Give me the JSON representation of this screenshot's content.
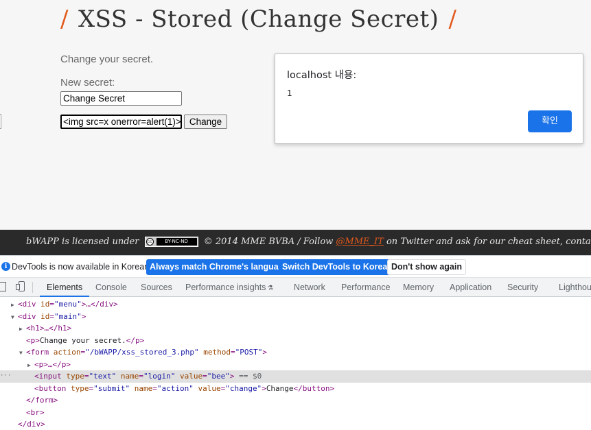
{
  "page": {
    "title": "XSS - Stored (Change Secret)",
    "title_slash": "/",
    "intro": "Change your secret.",
    "new_secret_label": "New secret:",
    "secret_value": "Change Secret",
    "login_value": "<img src=x onerror=alert(1)>",
    "change_label": "Change"
  },
  "dialog": {
    "title": "localhost 내용:",
    "message": "1",
    "ok_label": "확인"
  },
  "footer": {
    "licensed": "bWAPP is licensed under",
    "cc_icon": "cc",
    "cc_text": "BY-NC-ND",
    "follow": "© 2014 MME BVBA / Follow",
    "handle": "@MME_IT",
    "rest": "on Twitter and ask for our cheat sheet, contai"
  },
  "devtools": {
    "info_icon": "i",
    "info_text": "DevTools is now available in Korean!",
    "match_label": "Always match Chrome's language",
    "switch_label": "Switch DevTools to Korean",
    "dismiss_label": "Don't show again",
    "tabs": {
      "elements": "Elements",
      "console": "Console",
      "sources": "Sources",
      "performance_insights": "Performance insights",
      "network": "Network",
      "performance": "Performance",
      "memory": "Memory",
      "application": "Application",
      "security": "Security",
      "lighthouse": "Lighthou"
    },
    "dom": {
      "r1": {
        "tag": "<div",
        "a1": " id",
        "v1": "\"menu\"",
        "end": ">…</div>"
      },
      "r2": {
        "tag": "<div",
        "a1": " id",
        "v1": "\"main\"",
        "end": ">"
      },
      "r3": {
        "tag": "<h1>…</h1>"
      },
      "r4": {
        "open": "<p>",
        "text": "Change your secret.",
        "close": "</p>"
      },
      "r5": {
        "tag": "<form",
        "a1": " action",
        "v1": "\"/bWAPP/xss_stored_3.php\"",
        "a2": " method",
        "v2": "\"POST\"",
        "end": ">"
      },
      "r6": {
        "tag": "<p>…</p>"
      },
      "r7": {
        "tag": "<input",
        "a1": " type",
        "v1": "\"text\"",
        "a2": " name",
        "v2": "\"login\"",
        "a3": " value",
        "v3": "\"bee\"",
        "end": ">",
        "marker": " == $0"
      },
      "r8": {
        "tag": "<button",
        "a1": " type",
        "v1": "\"submit\"",
        "a2": " name",
        "v2": "\"action\"",
        "a3": " value",
        "v3": "\"change\"",
        "end": ">",
        "text": "Change",
        "close": "</button>"
      },
      "r9": {
        "tag": "</form>"
      },
      "r10": {
        "tag": "<br>"
      },
      "r11": {
        "tag": "</div>"
      }
    }
  }
}
